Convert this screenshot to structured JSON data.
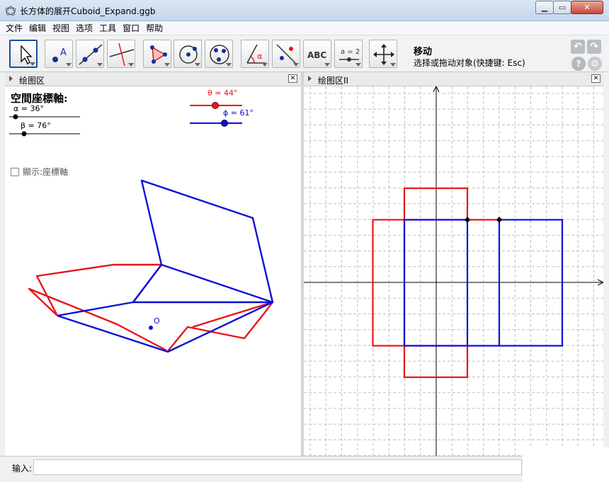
{
  "window": {
    "title": "长方体的展开Cuboid_Expand.ggb"
  },
  "menu": [
    "文件",
    "编辑",
    "视图",
    "选项",
    "工具",
    "窗口",
    "帮助"
  ],
  "toolbar": {
    "mode_name": "移动",
    "mode_help": "选择或拖动对象(快捷键: Esc)",
    "text_tool_label": "ABC",
    "slider_tool_label": "a = 2",
    "point_tool_label": "A",
    "angle_tool_label": "α"
  },
  "panel1": {
    "title": "绘图区",
    "heading": "空間座標軸:",
    "alpha_label": "α = 36°",
    "beta_label": "β = 76°",
    "theta_label": "θ = 44°",
    "phi_label": "ϕ = 61°",
    "checkbox_label": "顯示:座標軸",
    "origin_label": "O"
  },
  "panel2": {
    "title": "绘图区II"
  },
  "input_bar": {
    "label": "输入:",
    "value": ""
  },
  "sliders": {
    "alpha": 36,
    "beta": 76,
    "theta": 44,
    "phi": 61
  },
  "colors": {
    "red": "#e8141b",
    "blue": "#0a10d6",
    "accent": "#1c4f9c"
  }
}
